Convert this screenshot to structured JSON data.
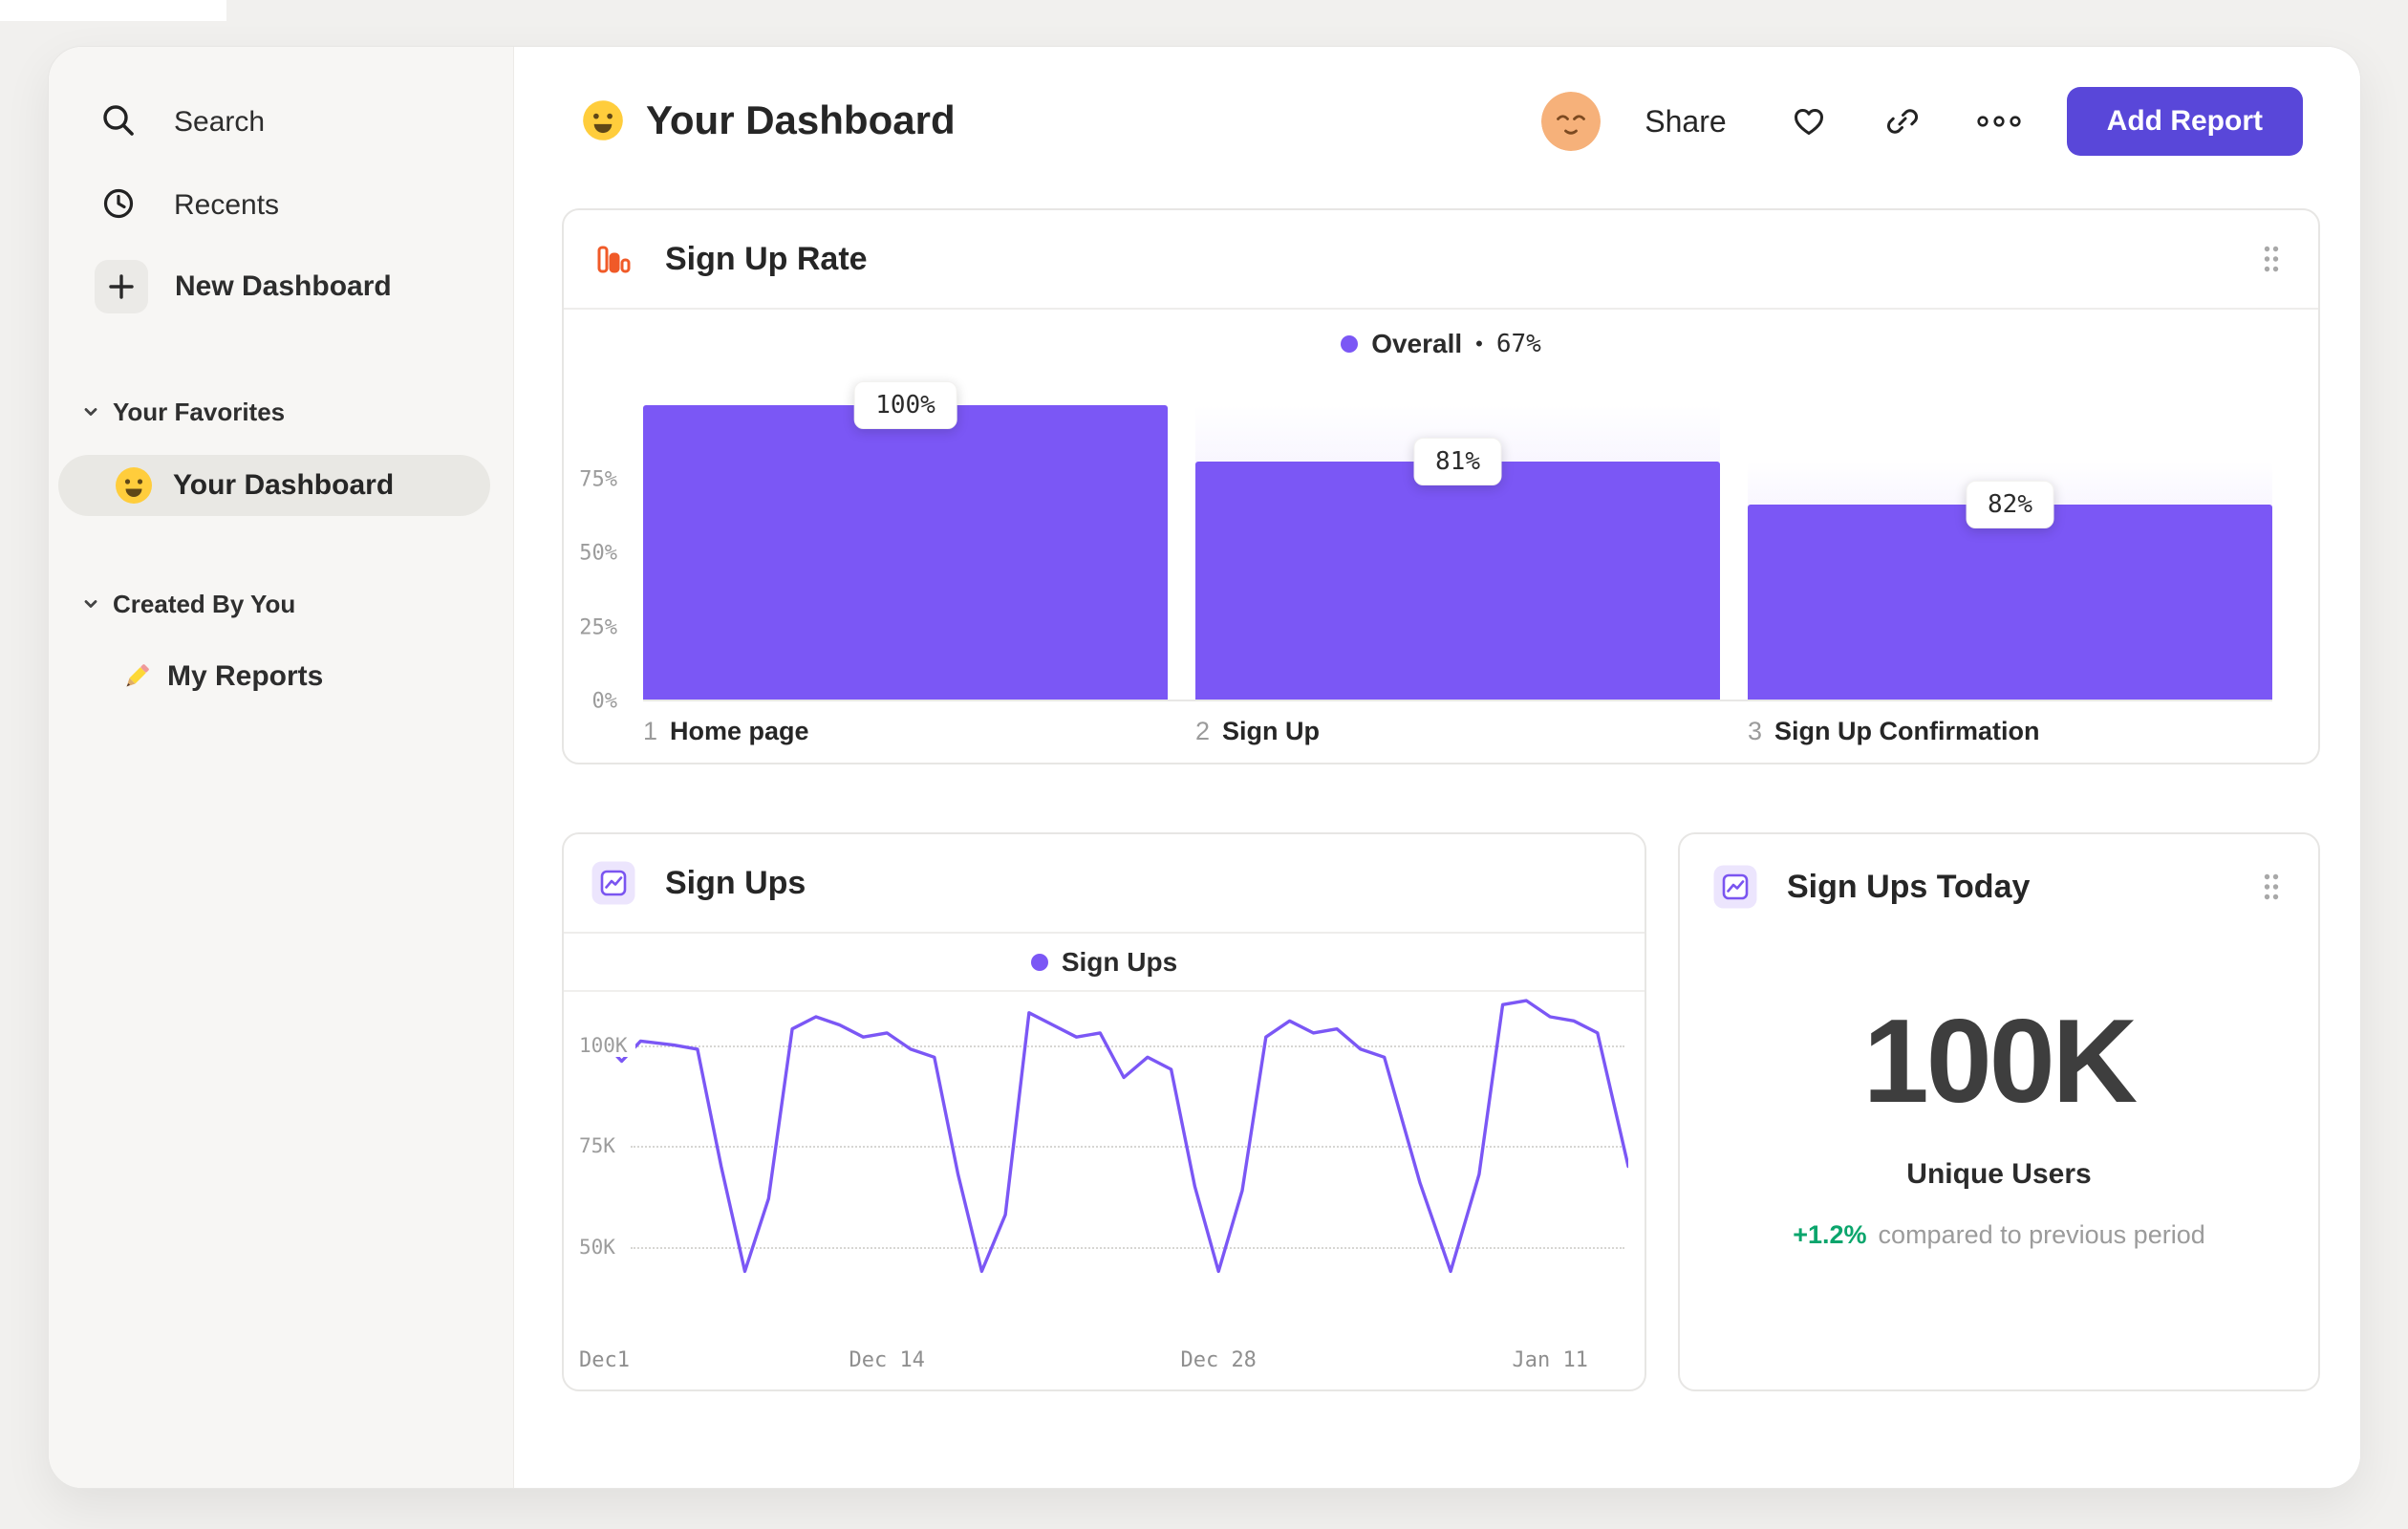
{
  "colors": {
    "accent_purple": "#7b57f5",
    "button_purple": "#5947d9",
    "funnel_icon_orange": "#f05a28",
    "delta_green": "#0aa56c",
    "sidebar_bg": "#f7f6f4",
    "page_bg": "#f1f0ee"
  },
  "icons": {
    "sidebar": [
      "search-icon",
      "clock-icon",
      "plus-icon",
      "chevron-down-icon",
      "smiley-icon",
      "pencil-icon"
    ],
    "header": [
      "smiley-icon",
      "avatar",
      "heart-icon",
      "link-icon",
      "more-icon"
    ],
    "cards": [
      "funnel-chart-icon",
      "line-chart-icon",
      "drag-handle-icon"
    ]
  },
  "sidebar": {
    "search": "Search",
    "recents": "Recents",
    "new_dashboard": "New Dashboard",
    "favorites_title": "Your Favorites",
    "favorite_item": "Your Dashboard",
    "created_title": "Created By You",
    "created_item": "My Reports"
  },
  "header": {
    "title": "Your Dashboard",
    "share": "Share",
    "add_report": "Add Report"
  },
  "funnel_card": {
    "title": "Sign Up Rate",
    "legend_label": "Overall",
    "legend_sep": "•",
    "legend_value": "67%"
  },
  "line_card": {
    "title": "Sign Ups",
    "legend_label": "Sign Ups"
  },
  "stat_card": {
    "title": "Sign Ups Today",
    "value": "100K",
    "label": "Unique Users",
    "delta": "+1.2%",
    "delta_note": "compared to previous period"
  },
  "chart_data": [
    {
      "type": "bar",
      "variant": "funnel",
      "title": "Sign Up Rate",
      "legend": "Overall • 67%",
      "overall_conversion_pct": 67,
      "y_range": [
        0,
        100
      ],
      "y_ticks": [
        [
          "75%",
          75
        ],
        [
          "50%",
          50
        ],
        [
          "25%",
          25
        ],
        [
          "0%",
          0
        ]
      ],
      "steps": [
        {
          "index": "1",
          "name": "Home page",
          "label": "100%",
          "prev_total": 100,
          "value": 100
        },
        {
          "index": "2",
          "name": "Sign Up",
          "label": "81%",
          "prev_total": 100,
          "value": 81
        },
        {
          "index": "3",
          "name": "Sign Up Confirmation",
          "label": "82%",
          "prev_total": 81,
          "value": 66.4
        }
      ]
    },
    {
      "type": "line",
      "title": "Sign Ups",
      "series": "Sign Ups",
      "unit": "K users per day",
      "grid": "dotted horizontal",
      "x_range": [
        0,
        44.3
      ],
      "y_range": [
        24,
        111.5
      ],
      "x_ticks": [
        [
          "Dec1",
          0
        ],
        [
          "Dec 14",
          13
        ],
        [
          "Dec 28",
          27
        ],
        [
          "Jan 11",
          41
        ]
      ],
      "y_ticks": [
        [
          "100K",
          100
        ],
        [
          "75K",
          75
        ],
        [
          "50K",
          50
        ]
      ],
      "points": [
        [
          0,
          98
        ],
        [
          1,
          101
        ],
        [
          1.8,
          96
        ],
        [
          2.6,
          101
        ],
        [
          4,
          100
        ],
        [
          5,
          99
        ],
        [
          6,
          70
        ],
        [
          7,
          44
        ],
        [
          8,
          62
        ],
        [
          9,
          104
        ],
        [
          10,
          107
        ],
        [
          11,
          105
        ],
        [
          12,
          102
        ],
        [
          13,
          103
        ],
        [
          14,
          99
        ],
        [
          15,
          97
        ],
        [
          16,
          68
        ],
        [
          17,
          44
        ],
        [
          18,
          58
        ],
        [
          19,
          108
        ],
        [
          20,
          105
        ],
        [
          21,
          102
        ],
        [
          22,
          103
        ],
        [
          23,
          92
        ],
        [
          24,
          97
        ],
        [
          25,
          94
        ],
        [
          26,
          65
        ],
        [
          27,
          44
        ],
        [
          28,
          64
        ],
        [
          29,
          102
        ],
        [
          30,
          106
        ],
        [
          31,
          103
        ],
        [
          32,
          104
        ],
        [
          33,
          99
        ],
        [
          34,
          97
        ],
        [
          35.5,
          66
        ],
        [
          36.8,
          44
        ],
        [
          38,
          68
        ],
        [
          39,
          110
        ],
        [
          40,
          111
        ],
        [
          41,
          107
        ],
        [
          42,
          106
        ],
        [
          43,
          103
        ],
        [
          44.3,
          70
        ]
      ]
    }
  ]
}
